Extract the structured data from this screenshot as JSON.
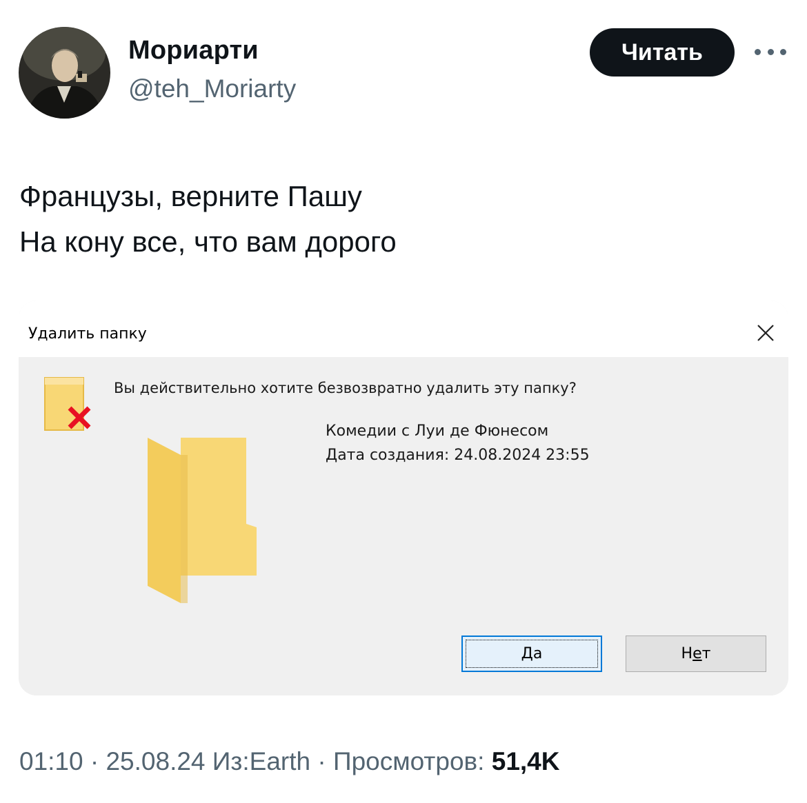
{
  "author": {
    "display_name": "Мориарти",
    "handle": "@teh_Moriarty"
  },
  "follow_button": {
    "label": "Читать"
  },
  "more_icon": "more-horizontal-icon",
  "tweet": {
    "line1": "Французы, верните Пашу",
    "line2": "На кону все, что вам дорого"
  },
  "dialog": {
    "title": "Удалить папку",
    "question": "Вы действительно хотите безвозвратно удалить эту папку?",
    "folder_name": "Комедии с Луи де Фюнесом",
    "created_date": "Дата создания: 24.08.2024 23:55",
    "yes_label_underlined": "Д",
    "yes_label_rest": "а",
    "no_label_start": "Н",
    "no_label_underlined": "е",
    "no_label_end": "т",
    "colors": {
      "folder": "#f8d775",
      "folder_dark": "#e6b946",
      "delete_x": "#e81123",
      "accent_button_border": "#0078d7"
    }
  },
  "meta": {
    "time": "01:10",
    "date": "25.08.24",
    "source": "Из:Earth",
    "views_label": "Просмотров:",
    "views_count": "51,4K"
  }
}
